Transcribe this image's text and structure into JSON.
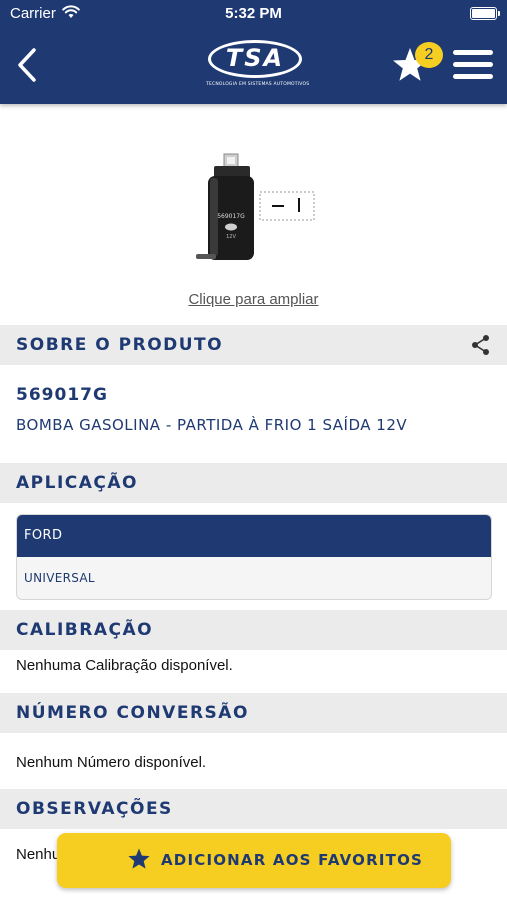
{
  "status_bar": {
    "carrier": "Carrier",
    "time": "5:32 PM"
  },
  "header": {
    "logo_text": "TSA",
    "logo_subtitle": "TECNOLOGIA EM SISTEMAS AUTOMOTIVOS",
    "favorites_count": "2"
  },
  "product": {
    "zoom_link": "Clique para ampliar",
    "code": "569017G",
    "description": "BOMBA GASOLINA - PARTIDA À FRIO 1 SAÍDA 12V"
  },
  "sections": {
    "about": "SOBRE O PRODUTO",
    "application": "APLICAÇÃO",
    "calibration": "CALIBRAÇÃO",
    "conversion": "NÚMERO CONVERSÃO",
    "observations": "OBSERVAÇÕES"
  },
  "application_table": {
    "brand": "FORD",
    "model": "UNIVERSAL"
  },
  "calibration_text": "Nenhuma Calibração disponível.",
  "conversion_text": "Nenhum Número disponível.",
  "observations_text": "Nenhu",
  "add_favorites_label": "ADICIONAR AOS FAVORITOS",
  "colors": {
    "primary": "#1f3a73",
    "accent": "#f6cd21",
    "section_bg": "#ebebeb"
  },
  "icons": [
    "wifi-icon",
    "battery-icon",
    "back-icon",
    "star-icon",
    "menu-icon",
    "share-icon"
  ]
}
